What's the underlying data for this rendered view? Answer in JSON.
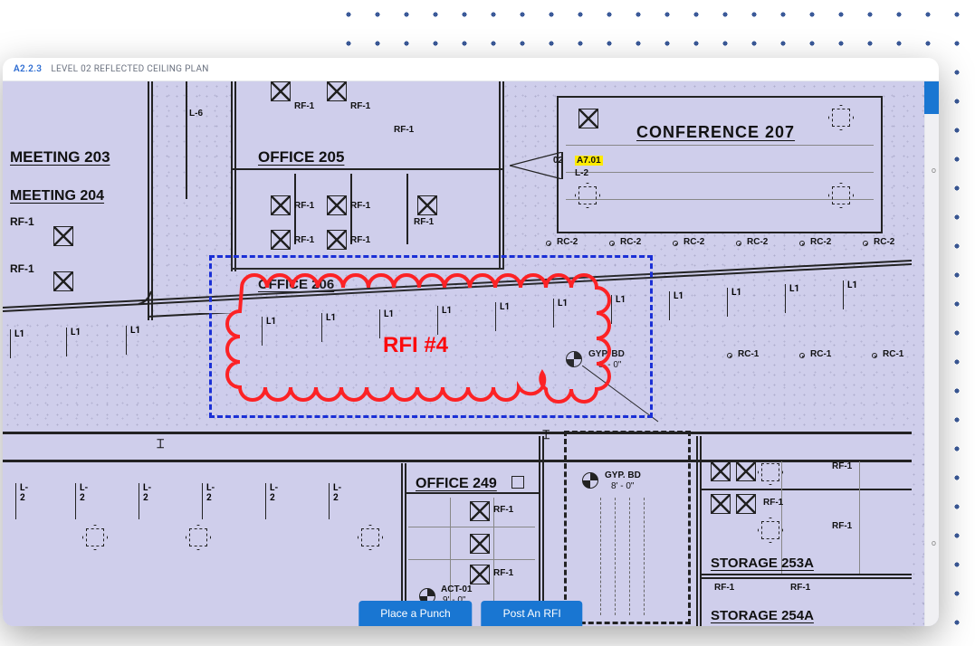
{
  "header": {
    "sheet_code": "A2.2.3",
    "sheet_title": "LEVEL 02 REFLECTED CEILING PLAN"
  },
  "annotation": {
    "selection_label": "RFI #4",
    "callout_ref": "A7.01",
    "callout_prefix": "02"
  },
  "rooms": {
    "meeting_203": "MEETING  203",
    "meeting_204": "MEETING  204",
    "office_205": "OFFICE  205",
    "office_206": "OFFICE  206",
    "office_249": "OFFICE  249",
    "conference_207": "CONFERENCE  207",
    "storage_253a": "STORAGE  253A",
    "storage_254a": "STORAGE  254A"
  },
  "tags": {
    "rf1": "RF-1",
    "l1": "L1",
    "l2": "L-2",
    "l6": "L-6",
    "l_2": "L-2",
    "rc1": "RC-1",
    "rc2": "RC-2",
    "gyp_bd": "GYP. BD",
    "gyp_bd_dim": "8' - 0\"",
    "act01": "ACT-01",
    "act01_dim": "9' - 0\""
  },
  "actions": {
    "place_punch": "Place a Punch",
    "post_rfi": "Post An RFI"
  }
}
